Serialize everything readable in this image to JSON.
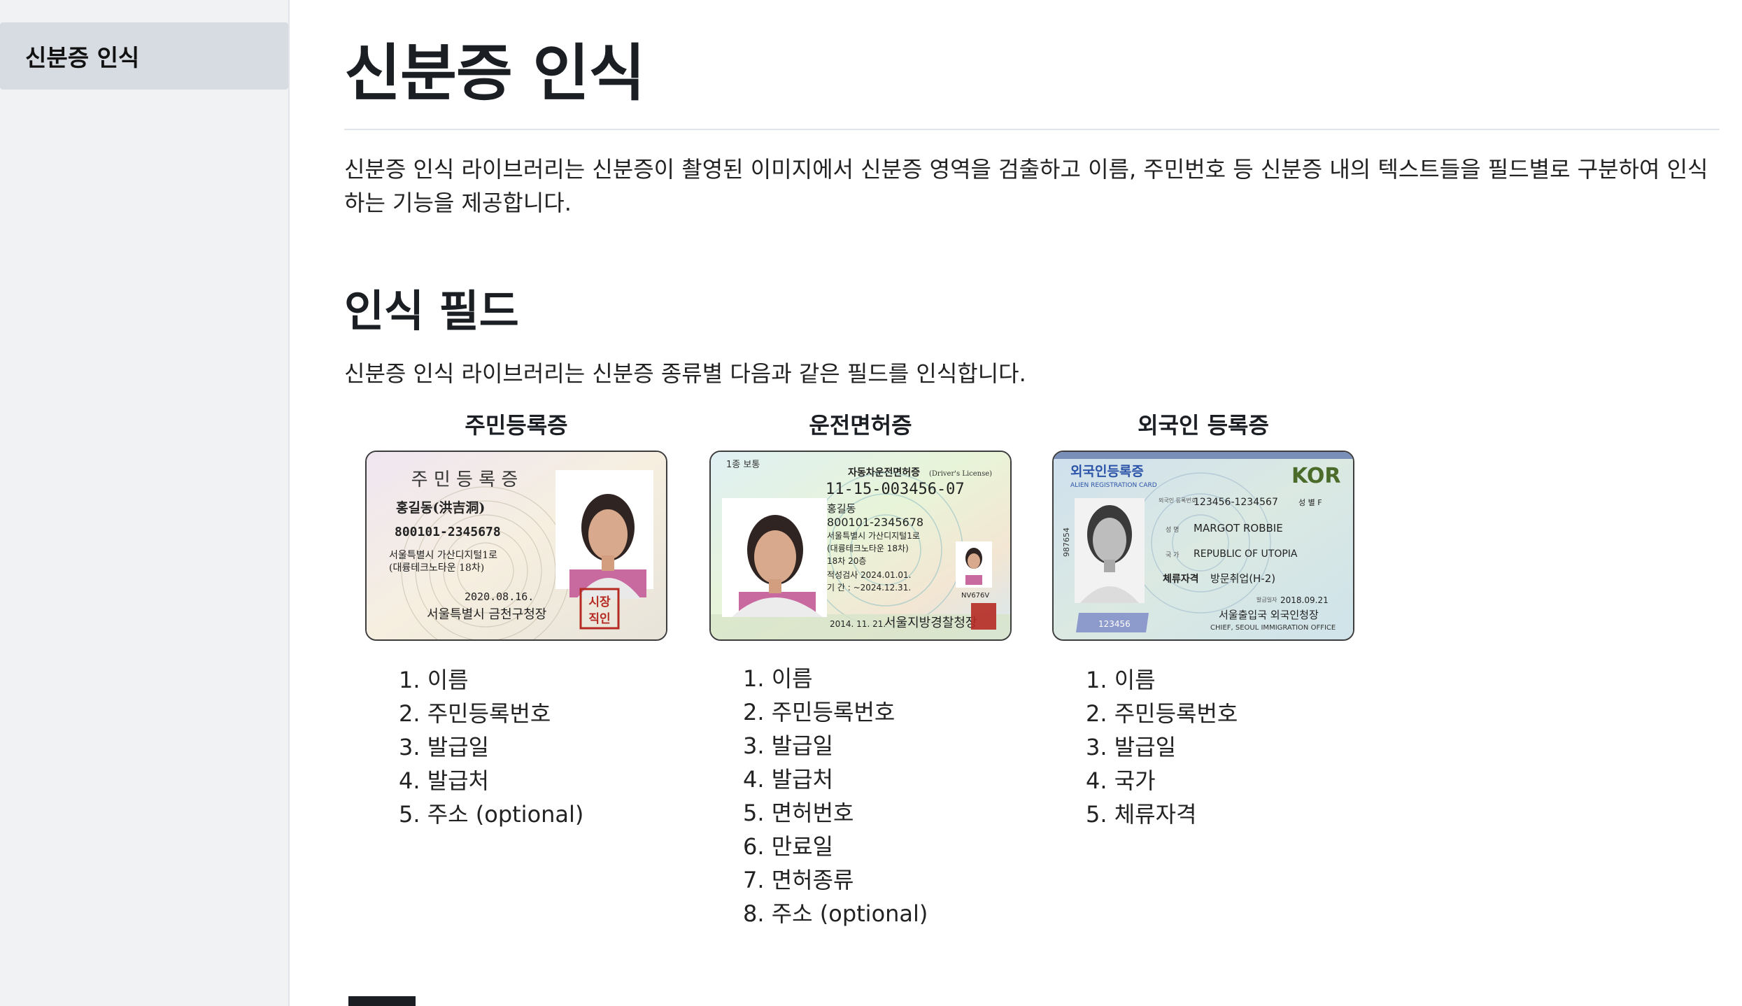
{
  "sidebar": {
    "items": [
      {
        "label": "신분증 인식",
        "active": true
      }
    ]
  },
  "page": {
    "title": "신분증 인식",
    "intro": "신분증 인식 라이브러리는 신분증이 촬영된 이미지에서 신분증 영역을 검출하고 이름, 주민번호 등 신분증 내의 텍스트들을 필드별로 구분하여 인식하는 기능을 제공합니다."
  },
  "fields_section": {
    "title": "인식 필드",
    "description": "신분증 인식 라이브러리는 신분증 종류별 다음과 같은 필드를 인식합니다.",
    "cards": [
      {
        "title": "주민등록증",
        "image_text": {
          "heading": "주 민 등 록 증",
          "name": "홍길동(洪吉洞)",
          "number": "800101-2345678",
          "address1": "서울특별시 가산디지털1로",
          "address2": "(대륭테크노타운 18차)",
          "date": "2020.08.16.",
          "issuer": "서울특별시 금천구청장",
          "seal": "시장직인"
        },
        "fields": [
          "1. 이름",
          "2. 주민등록번호",
          "3. 발급일",
          "4. 발급처",
          "5. 주소 (optional)"
        ]
      },
      {
        "title": "운전면허증",
        "image_text": {
          "class": "1종 보통",
          "heading": "자동차운전면허증",
          "heading_en": "(Driver's License)",
          "license_no": "11-15-003456-07",
          "name": "홍길동",
          "number": "800101-2345678",
          "address1": "서울특별시 가산디지털1로",
          "address2": "(대륭테크노타운 18차)",
          "address3": "18차 20층",
          "check": "적성검사  2024.01.01.",
          "period": "기    간 : ~2024.12.31.",
          "code": "NV676V",
          "issue_date": "2014. 11. 21.",
          "issuer": "서울지방경찰청장"
        },
        "fields": [
          "1. 이름",
          "2. 주민등록번호",
          "3. 발급일",
          "4. 발급처",
          "5. 면허번호",
          "6. 만료일",
          "7. 면허종류",
          "8. 주소 (optional)"
        ]
      },
      {
        "title": "외국인 등록증",
        "image_text": {
          "heading": "외국인등록증",
          "heading_en": "ALIEN REGISTRATION CARD",
          "country_code": "KOR",
          "reg_label": "외국인 등록번호",
          "reg_no": "123456-1234567",
          "sex": "성 별 F",
          "name_label": "성 명",
          "name": "MARGOT ROBBIE",
          "country_label": "국 가",
          "country": "REPUBLIC OF UTOPIA",
          "status_label": "체류자격",
          "status": "방문취업(H-2)",
          "side_no": "987654",
          "photo_no": "123456",
          "issue_label": "발급일자",
          "issue_date": "2018.09.21",
          "issuer": "서울출입국 외국인청장",
          "issuer_en": "CHIEF, SEOUL IMMIGRATION OFFICE"
        },
        "fields": [
          "1. 이름",
          "2. 주민등록번호",
          "3. 발급일",
          "4. 국가",
          "5. 체류자격"
        ]
      }
    ]
  },
  "colors": {
    "sidebar_bg": "#f1f2f4",
    "sidebar_active": "#d7dce3",
    "text": "#1b1f24",
    "seal_red": "#b52a23",
    "alien_blue": "#2c54a8",
    "kor_green": "#4a6b2a"
  }
}
